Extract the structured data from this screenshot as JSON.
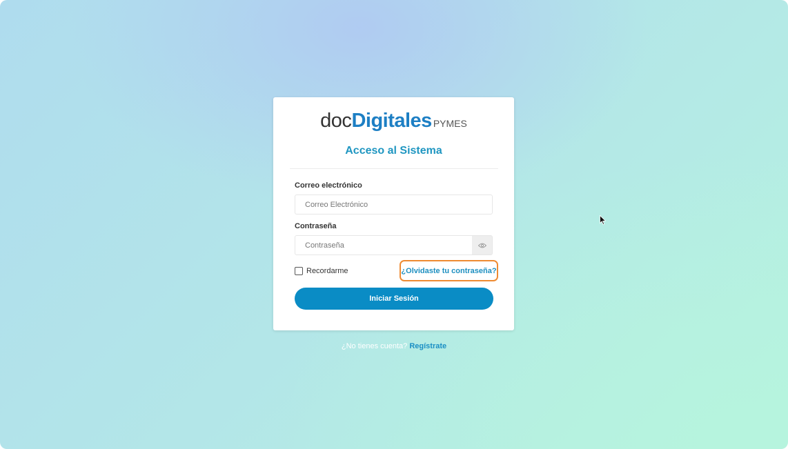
{
  "logo": {
    "part1": "doc",
    "part2": "Digitales",
    "part3": "PYMES"
  },
  "login": {
    "title": "Acceso al Sistema",
    "email_label": "Correo electrónico",
    "email_placeholder": "Correo Electrónico",
    "password_label": "Contraseña",
    "password_placeholder": "Contraseña",
    "remember_label": "Recordarme",
    "forgot_link": "¿Olvidaste tu contraseña?",
    "submit_label": "Iniciar Sesión"
  },
  "footer": {
    "question": "¿No tienes cuenta?",
    "register_link": "Regístrate"
  },
  "icons": {
    "password_toggle": "eye-icon",
    "pointer": "mouse-cursor-icon"
  },
  "colors": {
    "brand_blue": "#1d7fc4",
    "title_blue": "#1f96c1",
    "button_blue": "#0a8cc5",
    "highlight_orange": "#ee8a31"
  }
}
